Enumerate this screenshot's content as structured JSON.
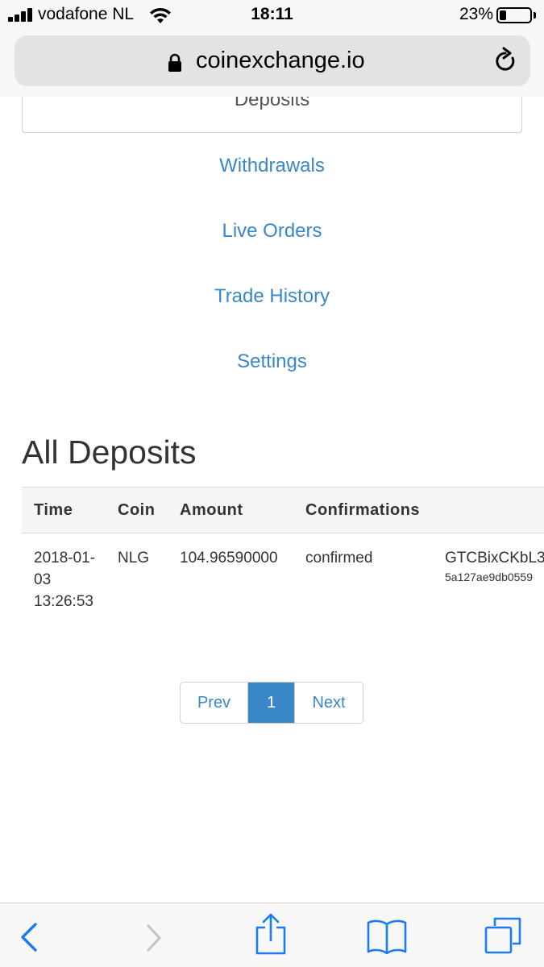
{
  "status_bar": {
    "carrier": "vodafone NL",
    "time": "18:11",
    "battery_percent": "23%",
    "battery_level": 0.23,
    "icons": [
      "signal-icon",
      "wifi-icon",
      "battery-icon"
    ]
  },
  "browser": {
    "url": "coinexchange.io",
    "icons": [
      "lock-icon",
      "reload-icon"
    ]
  },
  "nav": {
    "active": "Deposits",
    "links": [
      "Withdrawals",
      "Live Orders",
      "Trade History",
      "Settings"
    ]
  },
  "deposits": {
    "title": "All Deposits",
    "columns": [
      "Time",
      "Coin",
      "Amount",
      "Confirmations"
    ],
    "rows": [
      {
        "time": "2018-01-03 13:26:53",
        "coin": "NLG",
        "amount": "104.96590000",
        "confirmations": "confirmed",
        "address": "GTCBixCKbL3",
        "txid": "5a127ae9db0559"
      }
    ]
  },
  "pagination": {
    "prev": "Prev",
    "current": "1",
    "next": "Next"
  },
  "toolbar": {
    "icons": [
      "back-icon",
      "forward-icon",
      "share-icon",
      "bookmarks-icon",
      "tabs-icon"
    ]
  },
  "colors": {
    "link": "#3a87c8",
    "text": "#333333",
    "chrome": "#f7f7f7"
  }
}
